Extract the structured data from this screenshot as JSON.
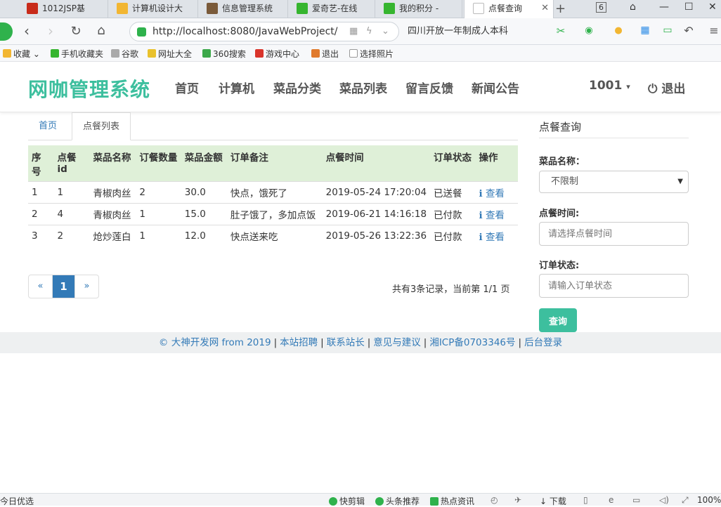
{
  "browser": {
    "tabs": [
      {
        "label": "1012JSP基",
        "icon_color": "#c82b1a"
      },
      {
        "label": "计算机设计大",
        "icon_color": "#f2b632"
      },
      {
        "label": "信息管理系统",
        "icon_color": "#7a5a3a"
      },
      {
        "label": "爱奇艺-在线",
        "icon_color": "#36b52f"
      },
      {
        "label": "我的积分 - ",
        "icon_color": "#36b52f"
      },
      {
        "label": "点餐查询",
        "icon_color": "#cccccc"
      }
    ],
    "tab_close": "✕",
    "new_tab": "+",
    "tab_count": "6",
    "url": "http://localhost:8080/JavaWebProject/",
    "search_text": "四川开放一年制成人本科",
    "bookmarks": [
      "收藏",
      "手机收藏夹",
      "谷歌",
      "网址大全",
      "360搜索",
      "游戏中心",
      "退出",
      "选择照片"
    ],
    "status_left": "今日优选",
    "status_items": [
      "快剪辑",
      "头条推荐",
      "热点资讯",
      "下载"
    ],
    "zoom": "100%"
  },
  "site": {
    "logo": "网咖管理系统",
    "menu": [
      "首页",
      "计算机",
      "菜品分类",
      "菜品列表",
      "留言反馈",
      "新闻公告"
    ],
    "user": "1001",
    "user_caret": "▾",
    "logout": "退出",
    "accent": "#3dbf9e"
  },
  "content": {
    "tabs": [
      "首页",
      "点餐列表"
    ],
    "columns": [
      "序号",
      "点餐id",
      "菜品名称",
      "订餐数量",
      "菜品金额",
      "订单备注",
      "点餐时间",
      "订单状态",
      "操作"
    ],
    "rows": [
      [
        "1",
        "1",
        "青椒肉丝",
        "2",
        "30.0",
        "快点，饿死了",
        "2019-05-24 17:20:04",
        "已送餐",
        "查看"
      ],
      [
        "2",
        "4",
        "青椒肉丝",
        "1",
        "15.0",
        "肚子饿了，多加点饭",
        "2019-06-21 14:16:18",
        "已付款",
        "查看"
      ],
      [
        "3",
        "2",
        "炝炒莲白",
        "1",
        "12.0",
        "快点送来吃",
        "2019-05-26 13:22:36",
        "已付款",
        "查看"
      ]
    ],
    "view_icon": "ℹ",
    "pager": {
      "prev": "«",
      "current": "1",
      "next": "»"
    },
    "record_info": "共有3条记录，当前第 1/1 页"
  },
  "sidebar": {
    "title": "点餐查询",
    "dish_label": "菜品名称：",
    "dish_value": "不限制",
    "time_label": "点餐时间:",
    "time_placeholder": "请选择点餐时间",
    "status_label": "订单状态:",
    "status_placeholder": "请输入订单状态",
    "query_button": "查询"
  },
  "footer": {
    "copyright": "© 大神开发网 from 2019",
    "links": [
      "本站招聘",
      "联系站长",
      "意见与建议",
      "湘ICP备0703346号",
      "后台登录"
    ]
  }
}
